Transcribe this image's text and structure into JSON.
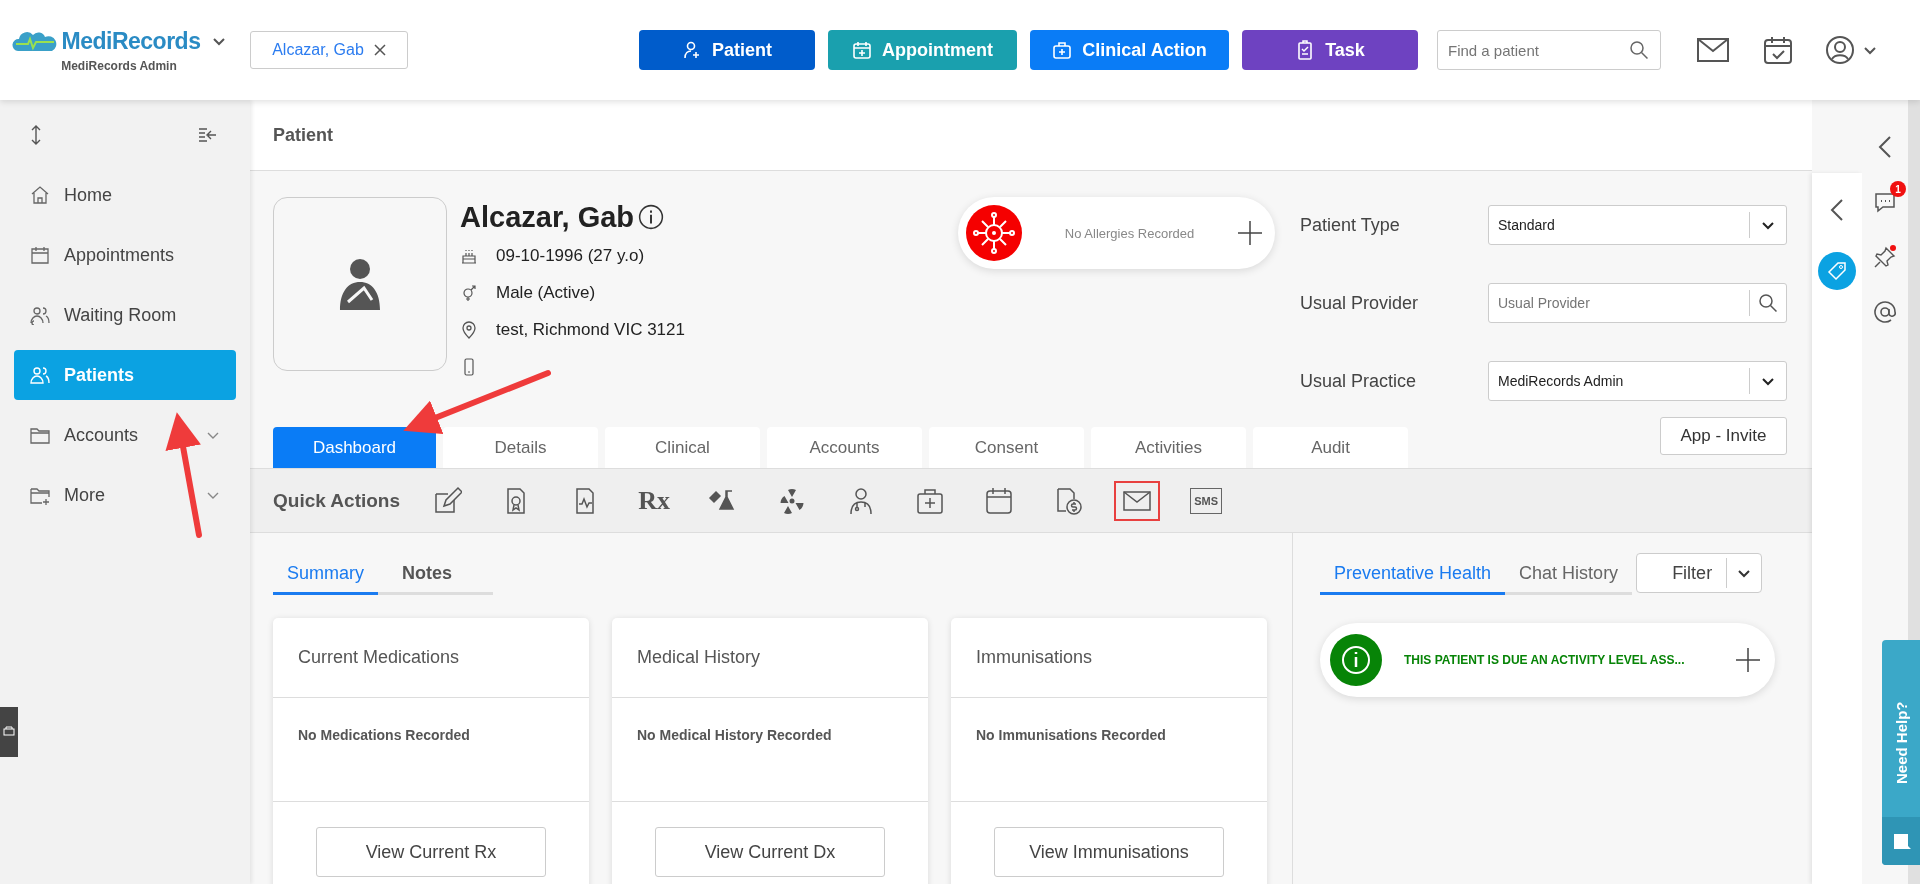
{
  "header": {
    "brand": "MediRecords",
    "brand_sub": "MediRecords Admin",
    "open_patient": "Alcazar, Gab",
    "actions": [
      {
        "label": "Patient",
        "kind": "patient",
        "color": "#005ccb"
      },
      {
        "label": "Appointment",
        "kind": "appointment",
        "color": "#1aa0ae"
      },
      {
        "label": "Clinical Action",
        "kind": "clinical",
        "color": "#0a7cf6"
      },
      {
        "label": "Task",
        "kind": "task",
        "color": "#6e42c1"
      }
    ],
    "search": {
      "placeholder": "Find a patient"
    }
  },
  "sidebar": {
    "items": [
      {
        "label": "Home",
        "kind": "home",
        "selected": false,
        "expandable": false
      },
      {
        "label": "Appointments",
        "kind": "calendar",
        "selected": false,
        "expandable": false
      },
      {
        "label": "Waiting Room",
        "kind": "waiting",
        "selected": false,
        "expandable": false
      },
      {
        "label": "Patients",
        "kind": "patients",
        "selected": true,
        "expandable": false
      },
      {
        "label": "Accounts",
        "kind": "folder",
        "selected": false,
        "expandable": true
      },
      {
        "label": "More",
        "kind": "folder-plus",
        "selected": false,
        "expandable": true
      }
    ]
  },
  "page_title": "Patient",
  "patient": {
    "name": "Alcazar, Gab",
    "dob": "09-10-1996 (27 y.o)",
    "gender": "Male (Active)",
    "address": "test, Richmond VIC 3121"
  },
  "allergies": {
    "text": "No Allergies Recorded"
  },
  "fields": [
    {
      "label": "Patient Type",
      "kind": "select",
      "value": "Standard"
    },
    {
      "label": "Usual Provider",
      "kind": "search",
      "placeholder": "Usual Provider"
    },
    {
      "label": "Usual Practice",
      "kind": "select",
      "value": "MediRecords Admin"
    }
  ],
  "app_invite": "App - Invite",
  "tabs": [
    {
      "label": "Dashboard",
      "selected": true
    },
    {
      "label": "Details",
      "selected": false
    },
    {
      "label": "Clinical",
      "selected": false
    },
    {
      "label": "Accounts",
      "selected": false
    },
    {
      "label": "Consent",
      "selected": false
    },
    {
      "label": "Activities",
      "selected": false
    },
    {
      "label": "Audit",
      "selected": false
    }
  ],
  "quick_actions": {
    "label": "Quick Actions",
    "items": [
      {
        "kind": "edit",
        "highlighted": false
      },
      {
        "kind": "certificate",
        "highlighted": false
      },
      {
        "kind": "chart",
        "highlighted": false
      },
      {
        "kind": "rx",
        "label": "Rx",
        "highlighted": false
      },
      {
        "kind": "lab",
        "highlighted": false
      },
      {
        "kind": "radiation",
        "highlighted": false
      },
      {
        "kind": "doctor",
        "highlighted": false
      },
      {
        "kind": "medkit",
        "highlighted": false
      },
      {
        "kind": "calendar",
        "highlighted": false
      },
      {
        "kind": "billing",
        "highlighted": false
      },
      {
        "kind": "mail",
        "highlighted": true
      },
      {
        "kind": "sms",
        "label": "SMS",
        "highlighted": false
      }
    ]
  },
  "summary_tabs": [
    {
      "label": "Summary",
      "selected": true
    },
    {
      "label": "Notes",
      "selected": false
    }
  ],
  "cards": [
    {
      "title": "Current Medications",
      "empty": "No Medications Recorded",
      "button": "View Current Rx"
    },
    {
      "title": "Medical History",
      "empty": "No Medical History Recorded",
      "button": "View Current Dx"
    },
    {
      "title": "Immunisations",
      "empty": "No Immunisations Recorded",
      "button": "View Immunisations"
    }
  ],
  "side_tabs": [
    {
      "label": "Preventative Health",
      "selected": true
    },
    {
      "label": "Chat History",
      "selected": false
    }
  ],
  "filter": "Filter",
  "alerts": [
    {
      "text": "THIS PATIENT IS DUE AN ACTIVITY LEVEL ASS..."
    }
  ],
  "right_rail": {
    "chat_badge": "1"
  },
  "need_help": "Need Help?"
}
